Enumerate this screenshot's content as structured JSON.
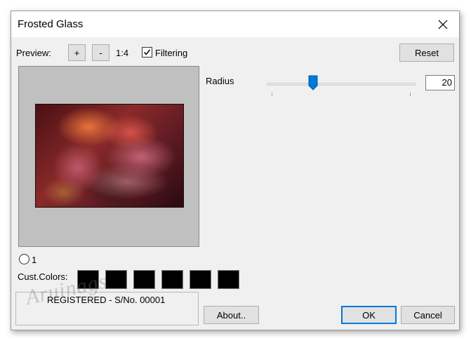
{
  "window": {
    "title": "Frosted Glass"
  },
  "toolbar": {
    "preview_label": "Preview:",
    "zoom_in_label": "+",
    "zoom_out_label": "-",
    "zoom_level": "1:4",
    "filtering_label": "Filtering",
    "filtering_checked": true,
    "reset_label": "Reset"
  },
  "params": {
    "radius_label": "Radius",
    "radius_value": "20",
    "radius_fraction": 0.3
  },
  "colors": {
    "radio_label": "1",
    "cust_colors_label": "Cust.Colors:",
    "swatches": [
      "#000000",
      "#000000",
      "#000000",
      "#000000",
      "#000000",
      "#000000"
    ]
  },
  "registration": {
    "text": "REGISTERED - S/No. 00001",
    "watermark": "Aruinags"
  },
  "buttons": {
    "about_label": "About..",
    "ok_label": "OK",
    "cancel_label": "Cancel"
  },
  "accent_color": "#0078d7"
}
